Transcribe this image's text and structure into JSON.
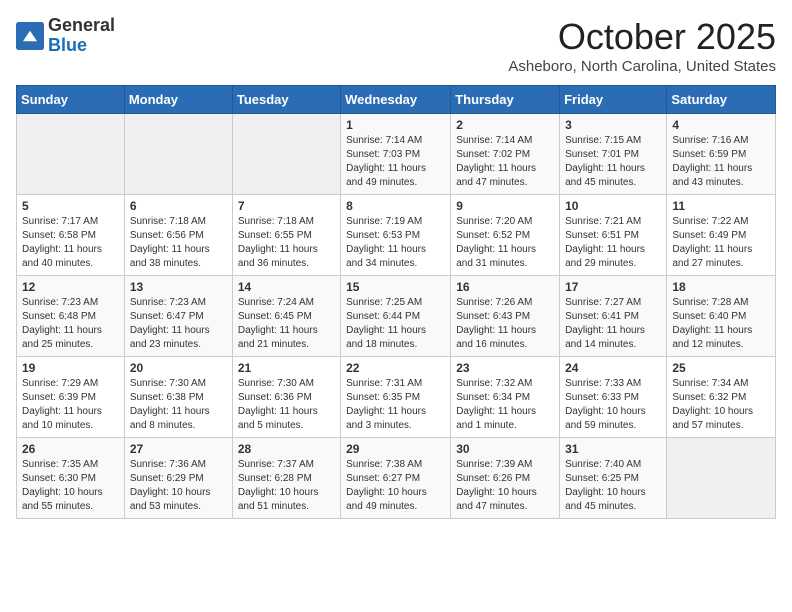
{
  "header": {
    "logo_general": "General",
    "logo_blue": "Blue",
    "month_title": "October 2025",
    "location": "Asheboro, North Carolina, United States"
  },
  "weekdays": [
    "Sunday",
    "Monday",
    "Tuesday",
    "Wednesday",
    "Thursday",
    "Friday",
    "Saturday"
  ],
  "weeks": [
    [
      {
        "day": "",
        "info": ""
      },
      {
        "day": "",
        "info": ""
      },
      {
        "day": "",
        "info": ""
      },
      {
        "day": "1",
        "info": "Sunrise: 7:14 AM\nSunset: 7:03 PM\nDaylight: 11 hours\nand 49 minutes."
      },
      {
        "day": "2",
        "info": "Sunrise: 7:14 AM\nSunset: 7:02 PM\nDaylight: 11 hours\nand 47 minutes."
      },
      {
        "day": "3",
        "info": "Sunrise: 7:15 AM\nSunset: 7:01 PM\nDaylight: 11 hours\nand 45 minutes."
      },
      {
        "day": "4",
        "info": "Sunrise: 7:16 AM\nSunset: 6:59 PM\nDaylight: 11 hours\nand 43 minutes."
      }
    ],
    [
      {
        "day": "5",
        "info": "Sunrise: 7:17 AM\nSunset: 6:58 PM\nDaylight: 11 hours\nand 40 minutes."
      },
      {
        "day": "6",
        "info": "Sunrise: 7:18 AM\nSunset: 6:56 PM\nDaylight: 11 hours\nand 38 minutes."
      },
      {
        "day": "7",
        "info": "Sunrise: 7:18 AM\nSunset: 6:55 PM\nDaylight: 11 hours\nand 36 minutes."
      },
      {
        "day": "8",
        "info": "Sunrise: 7:19 AM\nSunset: 6:53 PM\nDaylight: 11 hours\nand 34 minutes."
      },
      {
        "day": "9",
        "info": "Sunrise: 7:20 AM\nSunset: 6:52 PM\nDaylight: 11 hours\nand 31 minutes."
      },
      {
        "day": "10",
        "info": "Sunrise: 7:21 AM\nSunset: 6:51 PM\nDaylight: 11 hours\nand 29 minutes."
      },
      {
        "day": "11",
        "info": "Sunrise: 7:22 AM\nSunset: 6:49 PM\nDaylight: 11 hours\nand 27 minutes."
      }
    ],
    [
      {
        "day": "12",
        "info": "Sunrise: 7:23 AM\nSunset: 6:48 PM\nDaylight: 11 hours\nand 25 minutes."
      },
      {
        "day": "13",
        "info": "Sunrise: 7:23 AM\nSunset: 6:47 PM\nDaylight: 11 hours\nand 23 minutes."
      },
      {
        "day": "14",
        "info": "Sunrise: 7:24 AM\nSunset: 6:45 PM\nDaylight: 11 hours\nand 21 minutes."
      },
      {
        "day": "15",
        "info": "Sunrise: 7:25 AM\nSunset: 6:44 PM\nDaylight: 11 hours\nand 18 minutes."
      },
      {
        "day": "16",
        "info": "Sunrise: 7:26 AM\nSunset: 6:43 PM\nDaylight: 11 hours\nand 16 minutes."
      },
      {
        "day": "17",
        "info": "Sunrise: 7:27 AM\nSunset: 6:41 PM\nDaylight: 11 hours\nand 14 minutes."
      },
      {
        "day": "18",
        "info": "Sunrise: 7:28 AM\nSunset: 6:40 PM\nDaylight: 11 hours\nand 12 minutes."
      }
    ],
    [
      {
        "day": "19",
        "info": "Sunrise: 7:29 AM\nSunset: 6:39 PM\nDaylight: 11 hours\nand 10 minutes."
      },
      {
        "day": "20",
        "info": "Sunrise: 7:30 AM\nSunset: 6:38 PM\nDaylight: 11 hours\nand 8 minutes."
      },
      {
        "day": "21",
        "info": "Sunrise: 7:30 AM\nSunset: 6:36 PM\nDaylight: 11 hours\nand 5 minutes."
      },
      {
        "day": "22",
        "info": "Sunrise: 7:31 AM\nSunset: 6:35 PM\nDaylight: 11 hours\nand 3 minutes."
      },
      {
        "day": "23",
        "info": "Sunrise: 7:32 AM\nSunset: 6:34 PM\nDaylight: 11 hours\nand 1 minute."
      },
      {
        "day": "24",
        "info": "Sunrise: 7:33 AM\nSunset: 6:33 PM\nDaylight: 10 hours\nand 59 minutes."
      },
      {
        "day": "25",
        "info": "Sunrise: 7:34 AM\nSunset: 6:32 PM\nDaylight: 10 hours\nand 57 minutes."
      }
    ],
    [
      {
        "day": "26",
        "info": "Sunrise: 7:35 AM\nSunset: 6:30 PM\nDaylight: 10 hours\nand 55 minutes."
      },
      {
        "day": "27",
        "info": "Sunrise: 7:36 AM\nSunset: 6:29 PM\nDaylight: 10 hours\nand 53 minutes."
      },
      {
        "day": "28",
        "info": "Sunrise: 7:37 AM\nSunset: 6:28 PM\nDaylight: 10 hours\nand 51 minutes."
      },
      {
        "day": "29",
        "info": "Sunrise: 7:38 AM\nSunset: 6:27 PM\nDaylight: 10 hours\nand 49 minutes."
      },
      {
        "day": "30",
        "info": "Sunrise: 7:39 AM\nSunset: 6:26 PM\nDaylight: 10 hours\nand 47 minutes."
      },
      {
        "day": "31",
        "info": "Sunrise: 7:40 AM\nSunset: 6:25 PM\nDaylight: 10 hours\nand 45 minutes."
      },
      {
        "day": "",
        "info": ""
      }
    ]
  ]
}
